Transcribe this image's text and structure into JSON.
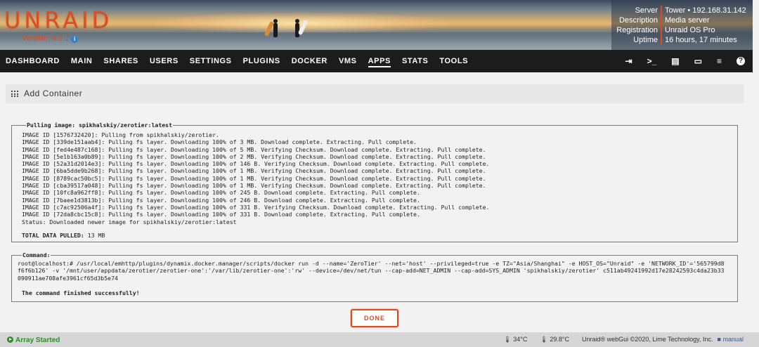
{
  "header": {
    "logo": "UNRAID",
    "version": "Version: 6.9.1",
    "info_icon": "i",
    "server_info": [
      {
        "label": "Server",
        "value": "Tower • 192.168.31.142"
      },
      {
        "label": "Description",
        "value": "Media server"
      },
      {
        "label": "Registration",
        "value": "Unraid OS Pro"
      },
      {
        "label": "Uptime",
        "value": "16 hours, 17 minutes"
      }
    ]
  },
  "nav": {
    "tabs": [
      "DASHBOARD",
      "MAIN",
      "SHARES",
      "USERS",
      "SETTINGS",
      "PLUGINS",
      "DOCKER",
      "VMS",
      "APPS",
      "STATS",
      "TOOLS"
    ],
    "active": "APPS",
    "icons": [
      "logout-icon",
      "terminal-icon",
      "feedback-icon",
      "display-icon",
      "log-icon",
      "help-icon"
    ],
    "help_glyph": "?"
  },
  "page": {
    "title": "Add Container"
  },
  "pull": {
    "legend": "Pulling image: spikhalskiy/zerotier:latest",
    "lines": [
      "IMAGE ID [1576732420]: Pulling from spikhalskiy/zerotier.",
      "IMAGE ID [339de151aab4]: Pulling fs layer. Downloading 100% of 3 MB. Download complete. Extracting. Pull complete.",
      "IMAGE ID [fed4e487c168]: Pulling fs layer. Downloading 100% of 5 MB. Verifying Checksum. Download complete. Extracting. Pull complete.",
      "IMAGE ID [5e1b163a0b89]: Pulling fs layer. Downloading 100% of 2 MB. Verifying Checksum. Download complete. Extracting. Pull complete.",
      "IMAGE ID [52a31d2014e3]: Pulling fs layer. Downloading 100% of 146 B. Verifying Checksum. Download complete. Extracting. Pull complete.",
      "IMAGE ID [6ba5dde9b268]: Pulling fs layer. Downloading 100% of 1 MB. Verifying Checksum. Download complete. Extracting. Pull complete.",
      "IMAGE ID [8789cac50bc5]: Pulling fs layer. Downloading 100% of 1 MB. Verifying Checksum. Download complete. Extracting. Pull complete.",
      "IMAGE ID [cba39517a048]: Pulling fs layer. Downloading 100% of 1 MB. Verifying Checksum. Download complete. Extracting. Pull complete.",
      "IMAGE ID [10fc8a962ff8]: Pulling fs layer. Downloading 100% of 245 B. Download complete. Extracting. Pull complete.",
      "IMAGE ID [7baee1d3813b]: Pulling fs layer. Downloading 100% of 246 B. Download complete. Extracting. Pull complete.",
      "IMAGE ID [c7ac92506a4f]: Pulling fs layer. Downloading 100% of 331 B. Verifying Checksum. Download complete. Extracting. Pull complete.",
      "IMAGE ID [72da8cbc15c8]: Pulling fs layer. Downloading 100% of 331 B. Download complete. Extracting. Pull complete.",
      "Status: Downloaded newer image for spikhalskiy/zerotier:latest"
    ],
    "total_label": "TOTAL DATA PULLED:",
    "total_value": "13 MB"
  },
  "command": {
    "legend": "Command:",
    "text": "root@localhost:# /usr/local/emhttp/plugins/dynamix.docker.manager/scripts/docker run -d --name='ZeroTier' --net='host' --privileged=true -e TZ=\"Asia/Shanghai\" -e HOST_OS=\"Unraid\" -e 'NETWORK_ID'='565799d8f6f6b126' -v '/mnt/user/appdata/zerotier/zerotier-one':'/var/lib/zerotier-one':'rw' --device=/dev/net/tun --cap-add=NET_ADMIN --cap-add=SYS_ADMIN 'spikhalskiy/zerotier' c511ab49241992d17e28242593c4da23b33090911ae708afe3961cf65d3b5e74",
    "finished": "The command finished successfully!"
  },
  "done_button": "DONE",
  "status_bar": {
    "array": "Array Started",
    "temp1": "34°C",
    "temp2": "29.8°C",
    "copyright": "Unraid® webGui ©2020, Lime Technology, Inc.",
    "manual": "manual"
  }
}
